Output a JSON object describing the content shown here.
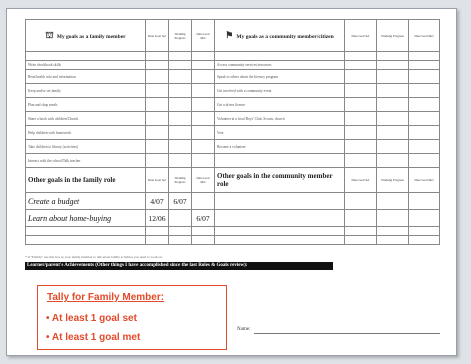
{
  "family_header": {
    "icon": "family-icon",
    "title": "My goals as a family member"
  },
  "community_header": {
    "icon": "community-icon",
    "title": "My goals as a community member/citizen"
  },
  "status_cols": [
    "Date Goal Set",
    "Working Progress",
    "Date Goal Met"
  ],
  "family_items": [
    "Write checkbook skills",
    "Read health info and information",
    "Keep and/or set family",
    "Plan and shop meals",
    "Share a book with children/Church",
    "Help children with homework",
    "Take children to library (activities)",
    "Interact with the school/Talk teacher"
  ],
  "community_items": [
    "Access community services/resources",
    "Speak to others about the literacy program",
    "Get involved with a community event",
    "Get a driver license",
    "Volunteer at a local Boys' Club, Scouts, church",
    "Vote",
    "Become a volunteer"
  ],
  "other_family": {
    "title": "Other goals in the family role",
    "rows": [
      {
        "text": "Create a budget",
        "set": "4/07",
        "progress": "6/07",
        "met": ""
      },
      {
        "text": "Learn about home-buying",
        "set": "12/06",
        "progress": "",
        "met": "6/07"
      }
    ]
  },
  "other_community": {
    "title": "Other goals in the community member role"
  },
  "footnote": "* If \"Family\" use this box as your family member to talk about family activities you need to work on.",
  "accomplishments_bar": "Learner/parent's Achievements (Other things I have accomplished since the last Roles & Goals review):",
  "tally": {
    "title": "Tally for Family Member:",
    "line1": "• At least 1 goal set",
    "line2": "• At least 1 goal met"
  },
  "name_label": "Name:",
  "colors": {
    "tally": "#e34a2a",
    "bar": "#111111"
  }
}
